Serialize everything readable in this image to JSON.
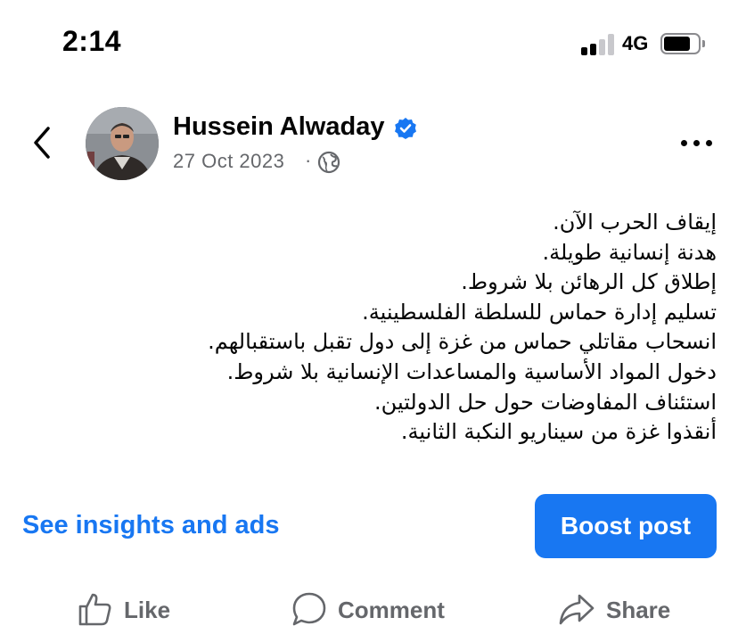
{
  "status_bar": {
    "time": "2:14",
    "network": "4G",
    "signal_bars_active": 2,
    "signal_bars_total": 4,
    "battery_level": 0.65
  },
  "header": {
    "back_icon": "chevron-left-icon",
    "author_name": "Hussein Alwaday",
    "verified_icon": "verified-badge-icon",
    "verified_color": "#1877f2",
    "date": "27 Oct 2023",
    "separator": "·",
    "audience_icon": "globe-icon",
    "more_icon": "more-horizontal-icon"
  },
  "post": {
    "direction": "rtl",
    "lines": [
      "إيقاف الحرب الآن.",
      "هدنة إنسانية طويلة.",
      "إطلاق كل الرهائن بلا شروط.",
      "تسليم إدارة حماس للسلطة الفلسطينية.",
      "انسحاب مقاتلي حماس من غزة إلى دول تقبل باستقبالهم.",
      "دخول المواد الأساسية والمساعدات الإنسانية بلا شروط.",
      "استئناف المفاوضات حول حل الدولتين.",
      "أنقذوا غزة من سيناريو النكبة الثانية."
    ]
  },
  "promo": {
    "insights_label": "See insights and ads",
    "boost_label": "Boost post",
    "accent_color": "#1877f2"
  },
  "actions": {
    "like": {
      "label": "Like",
      "icon": "thumbs-up-icon"
    },
    "comment": {
      "label": "Comment",
      "icon": "comment-bubble-icon"
    },
    "share": {
      "label": "Share",
      "icon": "share-arrow-icon"
    }
  }
}
